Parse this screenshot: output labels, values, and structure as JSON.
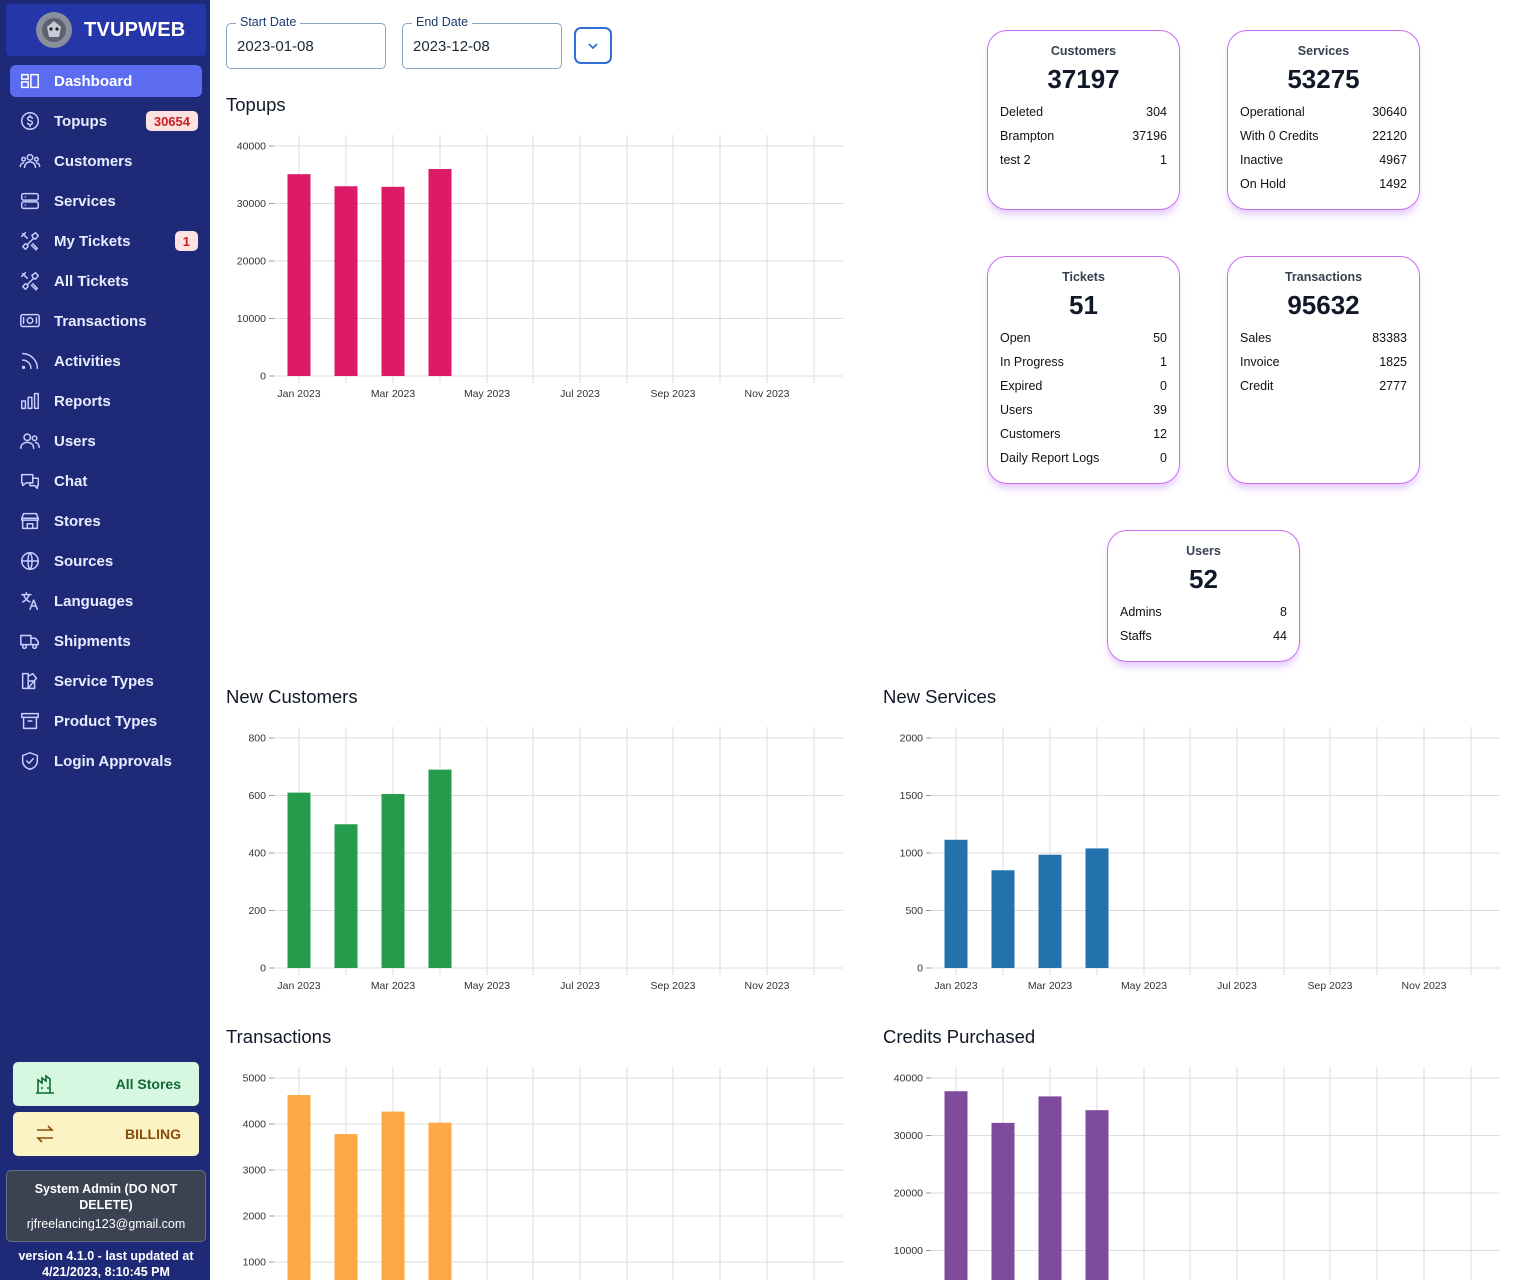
{
  "brand": {
    "name": "TVUPWEB"
  },
  "sidebar": {
    "items": [
      {
        "label": "Dashboard",
        "icon": "dashboard-icon",
        "active": true
      },
      {
        "label": "Topups",
        "icon": "dollar-icon",
        "badge": "30654"
      },
      {
        "label": "Customers",
        "icon": "customers-icon"
      },
      {
        "label": "Services",
        "icon": "server-icon"
      },
      {
        "label": "My Tickets",
        "icon": "tools-icon",
        "badge": "1"
      },
      {
        "label": "All Tickets",
        "icon": "tools-icon"
      },
      {
        "label": "Transactions",
        "icon": "money-icon"
      },
      {
        "label": "Activities",
        "icon": "rss-icon"
      },
      {
        "label": "Reports",
        "icon": "bar-chart-icon"
      },
      {
        "label": "Users",
        "icon": "users-icon"
      },
      {
        "label": "Chat",
        "icon": "chat-icon"
      },
      {
        "label": "Stores",
        "icon": "store-icon"
      },
      {
        "label": "Sources",
        "icon": "globe-icon"
      },
      {
        "label": "Languages",
        "icon": "translate-icon"
      },
      {
        "label": "Shipments",
        "icon": "truck-icon"
      },
      {
        "label": "Service Types",
        "icon": "swatch-icon"
      },
      {
        "label": "Product Types",
        "icon": "archive-icon"
      },
      {
        "label": "Login Approvals",
        "icon": "shield-check-icon"
      }
    ],
    "all_stores_label": "All Stores",
    "billing_label": "BILLING",
    "user_name": "System Admin (DO NOT DELETE)",
    "user_email": "rjfreelancing123@gmail.com",
    "version_text": "version 4.1.0 - last updated at 4/21/2023, 8:10:45 PM"
  },
  "filters": {
    "start_label": "Start Date",
    "start_value": "2023-01-08",
    "end_label": "End Date",
    "end_value": "2023-12-08"
  },
  "cards": [
    {
      "title": "Customers",
      "value": "37197",
      "rows": [
        [
          "Deleted",
          "304"
        ],
        [
          "Brampton",
          "37196"
        ],
        [
          "test 2",
          "1"
        ]
      ]
    },
    {
      "title": "Services",
      "value": "53275",
      "rows": [
        [
          "Operational",
          "30640"
        ],
        [
          "With 0 Credits",
          "22120"
        ],
        [
          "Inactive",
          "4967"
        ],
        [
          "On Hold",
          "1492"
        ]
      ]
    },
    {
      "title": "Tickets",
      "value": "51",
      "rows": [
        [
          "Open",
          "50"
        ],
        [
          "In Progress",
          "1"
        ],
        [
          "Expired",
          "0"
        ],
        [
          "Users",
          "39"
        ],
        [
          "Customers",
          "12"
        ],
        [
          "Daily Report Logs",
          "0"
        ]
      ]
    },
    {
      "title": "Transactions",
      "value": "95632",
      "rows": [
        [
          "Sales",
          "83383"
        ],
        [
          "Invoice",
          "1825"
        ],
        [
          "Credit",
          "2777"
        ]
      ]
    },
    {
      "title": "Users",
      "value": "52",
      "rows": [
        [
          "Admins",
          "8"
        ],
        [
          "Staffs",
          "44"
        ]
      ]
    }
  ],
  "colors": {
    "sidebar": "#1e2a78",
    "active": "#5b6cf0",
    "card_border": "#c86ff2"
  },
  "chart_data": [
    {
      "id": "topups",
      "type": "bar",
      "title": "Topups",
      "color": "#dc1a67",
      "x_tick_labels": [
        "Jan 2023",
        "Mar 2023",
        "May 2023",
        "Jul 2023",
        "Sep 2023",
        "Nov 2023"
      ],
      "categories": [
        "Jan 2023",
        "Feb 2023",
        "Mar 2023",
        "Apr 2023"
      ],
      "values": [
        35100,
        33000,
        32900,
        36000
      ],
      "yticks": [
        0,
        10000,
        20000,
        30000,
        40000
      ],
      "ylim": [
        0,
        40000
      ],
      "grid": true
    },
    {
      "id": "new-customers",
      "type": "bar",
      "title": "New Customers",
      "color": "#259b4c",
      "x_tick_labels": [
        "Jan 2023",
        "Mar 2023",
        "May 2023",
        "Jul 2023",
        "Sep 2023",
        "Nov 2023"
      ],
      "categories": [
        "Jan 2023",
        "Feb 2023",
        "Mar 2023",
        "Apr 2023"
      ],
      "values": [
        610,
        500,
        605,
        690
      ],
      "yticks": [
        0,
        200,
        400,
        600,
        800
      ],
      "ylim": [
        0,
        800
      ],
      "grid": true
    },
    {
      "id": "new-services",
      "type": "bar",
      "title": "New Services",
      "color": "#2472ad",
      "x_tick_labels": [
        "Jan 2023",
        "Mar 2023",
        "May 2023",
        "Jul 2023",
        "Sep 2023",
        "Nov 2023"
      ],
      "categories": [
        "Jan 2023",
        "Feb 2023",
        "Mar 2023",
        "Apr 2023"
      ],
      "values": [
        1115,
        850,
        985,
        1040
      ],
      "yticks": [
        0,
        500,
        1000,
        1500,
        2000
      ],
      "ylim": [
        0,
        2000
      ],
      "grid": true
    },
    {
      "id": "transactions",
      "type": "bar",
      "title": "Transactions",
      "color": "#fda844",
      "x_tick_labels": [],
      "categories": [
        "Jan 2023",
        "Feb 2023",
        "Mar 2023",
        "Apr 2023"
      ],
      "values": [
        4630,
        3780,
        4270,
        4030
      ],
      "yticks": [
        1000,
        2000,
        3000,
        4000,
        5000
      ],
      "ylim": [
        0,
        5000
      ],
      "grid": true
    },
    {
      "id": "credits-purchased",
      "type": "bar",
      "title": "Credits Purchased",
      "color": "#7d4a9c",
      "x_tick_labels": [],
      "categories": [
        "Jan 2023",
        "Feb 2023",
        "Mar 2023",
        "Apr 2023"
      ],
      "values": [
        37700,
        32200,
        36800,
        34400
      ],
      "yticks": [
        10000,
        20000,
        30000,
        40000
      ],
      "ylim": [
        0,
        40000
      ],
      "grid": true
    }
  ]
}
